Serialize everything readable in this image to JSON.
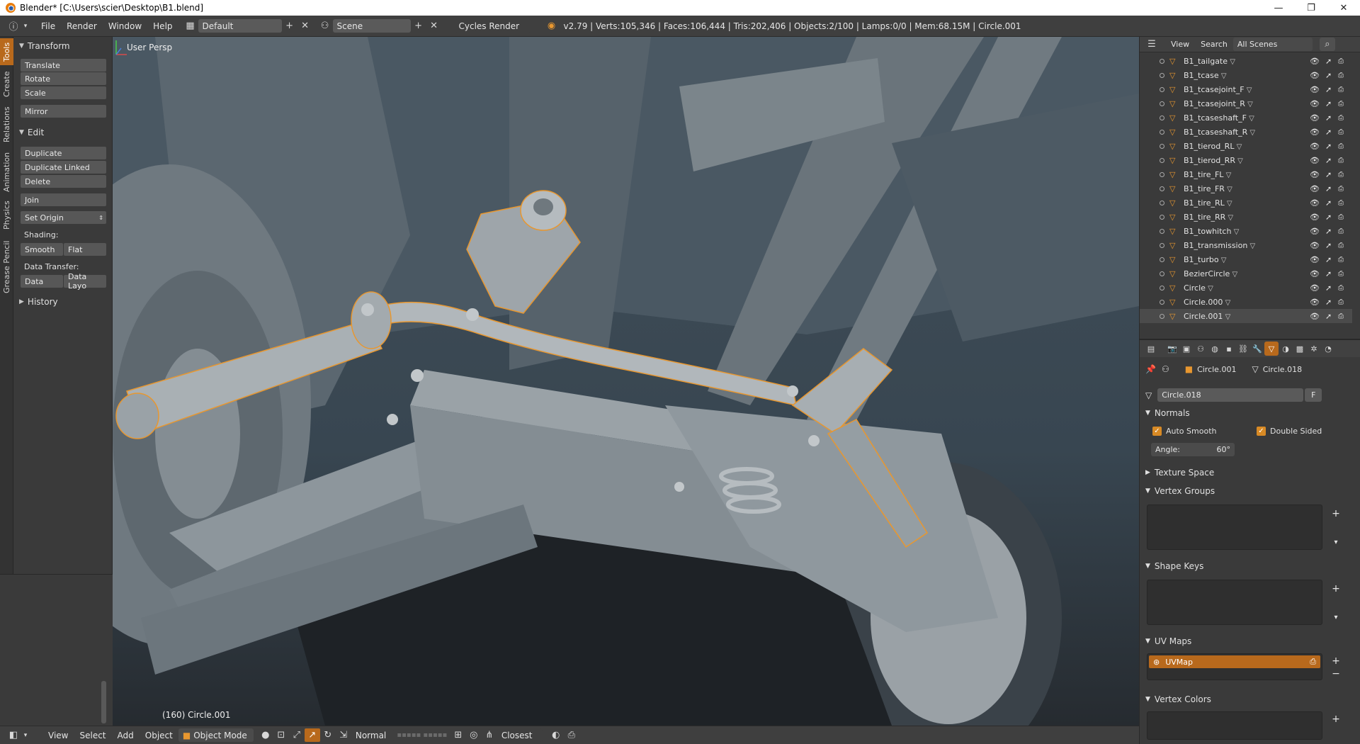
{
  "window": {
    "title": "Blender* [C:\\Users\\scier\\Desktop\\B1.blend]",
    "minimize": "—",
    "maximize": "❐",
    "close": "✕"
  },
  "info_header": {
    "menus": [
      "File",
      "Render",
      "Window",
      "Help"
    ],
    "layout": "Default",
    "scene": "Scene",
    "render_engine": "Cycles Render",
    "stats": "v2.79 | Verts:105,346 | Faces:106,444 | Tris:202,406 | Objects:2/100 | Lamps:0/0 | Mem:68.15M | Circle.001"
  },
  "tool_tabs": [
    "Tools",
    "Create",
    "Relations",
    "Animation",
    "Physics",
    "Grease Pencil"
  ],
  "toolshelf": {
    "transform_title": "Transform",
    "translate": "Translate",
    "rotate": "Rotate",
    "scale": "Scale",
    "mirror": "Mirror",
    "edit_title": "Edit",
    "duplicate": "Duplicate",
    "duplicate_linked": "Duplicate Linked",
    "delete": "Delete",
    "join": "Join",
    "set_origin": "Set Origin",
    "shading_label": "Shading:",
    "smooth": "Smooth",
    "flat": "Flat",
    "data_transfer_label": "Data Transfer:",
    "data": "Data",
    "data_layout": "Data Layo",
    "history_title": "History"
  },
  "viewport": {
    "view_label": "User Persp",
    "object_label": "(160) Circle.001"
  },
  "bottom_header": {
    "menus": [
      "View",
      "Select",
      "Add",
      "Object"
    ],
    "mode": "Object Mode",
    "orientation": "Normal",
    "snap": "Closest"
  },
  "outliner": {
    "view": "View",
    "search": "Search",
    "scene_filter": "All Scenes",
    "items": [
      {
        "name": "B1_tailgate",
        "active": false
      },
      {
        "name": "B1_tcase",
        "active": false
      },
      {
        "name": "B1_tcasejoint_F",
        "active": false
      },
      {
        "name": "B1_tcasejoint_R",
        "active": false
      },
      {
        "name": "B1_tcaseshaft_F",
        "active": false
      },
      {
        "name": "B1_tcaseshaft_R",
        "active": false
      },
      {
        "name": "B1_tierod_RL",
        "active": false
      },
      {
        "name": "B1_tierod_RR",
        "active": false
      },
      {
        "name": "B1_tire_FL",
        "active": false
      },
      {
        "name": "B1_tire_FR",
        "active": false
      },
      {
        "name": "B1_tire_RL",
        "active": false
      },
      {
        "name": "B1_tire_RR",
        "active": false
      },
      {
        "name": "B1_towhitch",
        "active": false
      },
      {
        "name": "B1_transmission",
        "active": false
      },
      {
        "name": "B1_turbo",
        "active": false
      },
      {
        "name": "BezierCircle",
        "active": false
      },
      {
        "name": "Circle",
        "active": false
      },
      {
        "name": "Circle.000",
        "active": false
      },
      {
        "name": "Circle.001",
        "active": true
      }
    ]
  },
  "properties": {
    "breadcrumb_object": "Circle.001",
    "breadcrumb_mesh": "Circle.018",
    "mesh_name": "Circle.018",
    "fake_user": "F",
    "normals_title": "Normals",
    "auto_smooth": "Auto Smooth",
    "double_sided": "Double Sided",
    "angle_label": "Angle:",
    "angle_value": "60°",
    "texture_space_title": "Texture Space",
    "vertex_groups_title": "Vertex Groups",
    "shape_keys_title": "Shape Keys",
    "uv_maps_title": "UV Maps",
    "uv_map_name": "UVMap",
    "vertex_colors_title": "Vertex Colors"
  },
  "colors": {
    "accent": "#b8691c",
    "selection_outline": "#e8972f",
    "background": "#393939"
  }
}
